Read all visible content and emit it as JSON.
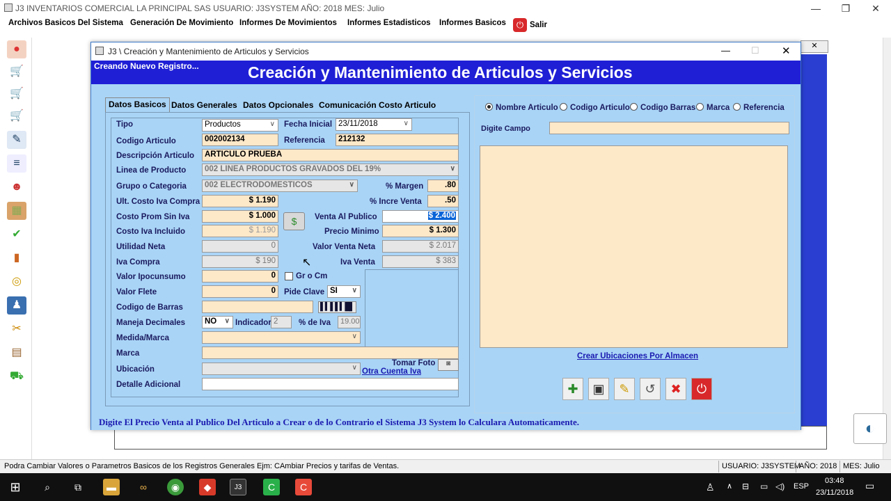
{
  "app": {
    "title": "J3 INVENTARIOS COMERCIAL LA PRINCIPAL SAS USUARIO: J3SYSTEM AÑO: 2018 MES: Julio",
    "window_controls": {
      "minimize": "—",
      "maximize": "❐",
      "close": "✕"
    }
  },
  "menu": {
    "items": [
      "Archivos Basicos Del Sistema",
      "Generación De Movimiento",
      "Informes De Movimientos",
      "Informes Estadisticos",
      "Informes Basicos"
    ],
    "salir": "Salir"
  },
  "left_toolbar": {
    "icons": [
      "folder-icon",
      "cart-icon",
      "cart-add-icon",
      "cart-remove-icon",
      "document-edit-icon",
      "document-icon",
      "user-icon",
      "box-icon",
      "checklist-icon",
      "chart-icon",
      "coins-icon",
      "group-icon",
      "tools-icon",
      "report-icon",
      "forklift-icon"
    ]
  },
  "dialog": {
    "title": "J3 \\ Creación y Mantenimiento de Articulos y Servicios",
    "subtitle": "Creando Nuevo Registro...",
    "heading": "Creación y Mantenimiento de Articulos y Servicios",
    "tabs": [
      "Datos Basicos",
      "Datos Generales",
      "Datos Opcionales",
      "Comunicación Costo Articulo"
    ],
    "form": {
      "tipo_label": "Tipo",
      "tipo_value": "Productos",
      "fecha_label": "Fecha Inicial",
      "fecha_value": "23/11/2018",
      "codigo_label": "Codigo Articulo",
      "codigo_value": "002002134",
      "referencia_label": "Referencia",
      "referencia_value": "212132",
      "descripcion_label": "Descripción Articulo",
      "descripcion_value": "ARTICULO PRUEBA",
      "linea_label": "Linea de Producto",
      "linea_value": "002 LINEA PRODUCTOS GRAVADOS DEL 19%",
      "grupo_label": "Grupo o Categoria",
      "grupo_value": "002 ELECTRODOMESTICOS",
      "margen_label": "% Margen",
      "margen_value": ".80",
      "ult_costo_label": "Ult. Costo Iva Compra",
      "ult_costo_value": "$ 1.190",
      "incre_label": "% Incre Venta",
      "incre_value": ".50",
      "costo_prom_label": "Costo Prom Sin Iva",
      "costo_prom_value": "$ 1.000",
      "venta_publico_label": "Venta Al Publico",
      "venta_publico_value": "$ 2.400",
      "costo_iva_label": "Costo Iva Incluido",
      "costo_iva_value": "$ 1.190",
      "precio_min_label": "Precio Minimo",
      "precio_min_value": "$ 1.300",
      "utilidad_label": "Utilidad Neta",
      "utilidad_value": "0",
      "valor_venta_label": "Valor Venta Neta",
      "valor_venta_value": "$ 2.017",
      "iva_compra_label": "Iva Compra",
      "iva_compra_value": "$ 190",
      "iva_venta_label": "Iva Venta",
      "iva_venta_value": "$ 383",
      "ipocunsumo_label": "Valor Ipocunsumo",
      "ipocunsumo_value": "0",
      "grocm_label": "Gr o Cm",
      "flete_label": "Valor Flete",
      "flete_value": "0",
      "pide_clave_label": "Pide Clave",
      "pide_clave_value": "SI",
      "barras_label": "Codigo de Barras",
      "barras_value": "",
      "decimales_label": "Maneja Decimales",
      "decimales_value": "NO",
      "indicador_label": "Indicador",
      "indicador_value": "2",
      "pct_iva_label": "% de Iva",
      "pct_iva_value": "19.00",
      "medida_label": "Medida/Marca",
      "medida_value": "",
      "marca_label": "Marca",
      "marca_value": "",
      "ubicacion_label": "Ubicación",
      "ubicacion_value": "",
      "tomar_foto_label": "Tomar Foto",
      "otra_cuenta_link": "Otra Cuenta Iva",
      "detalle_label": "Detalle Adicional",
      "detalle_value": ""
    },
    "search": {
      "options": [
        "Nombre Articulo",
        "Codigo Articulo",
        "Codigo Barras",
        "Marca",
        "Referencia"
      ],
      "selected": "Nombre Articulo",
      "digite_label": "Digite Campo",
      "digite_value": ""
    },
    "ubicaciones_link": "Crear Ubicaciones Por Almacen",
    "toolbar_buttons": [
      "new-icon",
      "save-icon",
      "edit-icon",
      "undo-icon",
      "delete-icon",
      "exit-icon"
    ],
    "status_message": "Digite El Precio Venta al Publico Del Articulo a Crear o de lo Contrario el Sistema J3 System lo Calculara Automaticamente."
  },
  "statusbar": {
    "message": "Podra Cambiar Valores o Parametros Basicos de los Registros Generales Ejm: CAmbiar Precios y tarifas de Ventas.",
    "usuario": "USUARIO: J3SYSTEM",
    "anio": "AÑO: 2018",
    "mes": "MES: Julio"
  },
  "taskbar": {
    "language": "ESP",
    "time": "03:48",
    "date": "23/11/2018"
  },
  "colors": {
    "dialog_bg": "#a9d4f6",
    "header_blue": "#1f1fd6",
    "field_peach": "#fde8c8",
    "status_text": "#1a1ab0"
  }
}
